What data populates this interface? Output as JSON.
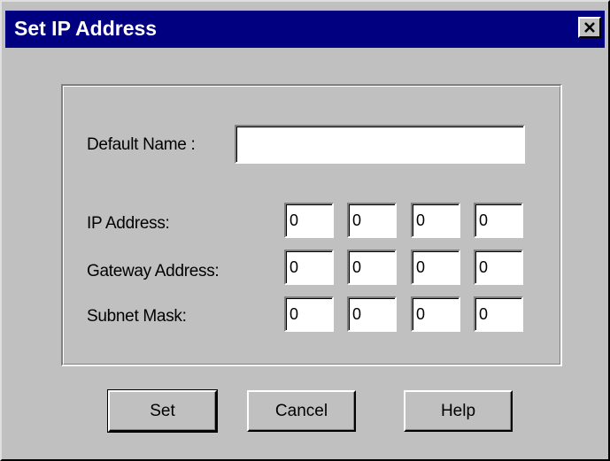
{
  "window": {
    "title": "Set IP Address",
    "close_icon": "close-x-icon"
  },
  "form": {
    "default_name_label": "Default Name :",
    "default_name_value": "",
    "ip_address_label": "IP Address:",
    "ip_address": [
      "0",
      "0",
      "0",
      "0"
    ],
    "gateway_address_label": "Gateway Address:",
    "gateway_address": [
      "0",
      "0",
      "0",
      "0"
    ],
    "subnet_mask_label": "Subnet Mask:",
    "subnet_mask": [
      "0",
      "0",
      "0",
      "0"
    ]
  },
  "buttons": {
    "set_label": "Set",
    "cancel_label": "Cancel",
    "help_label": "Help"
  },
  "colors": {
    "titlebar": "#000080",
    "face": "#c0c0c0",
    "field": "#ffffff"
  }
}
